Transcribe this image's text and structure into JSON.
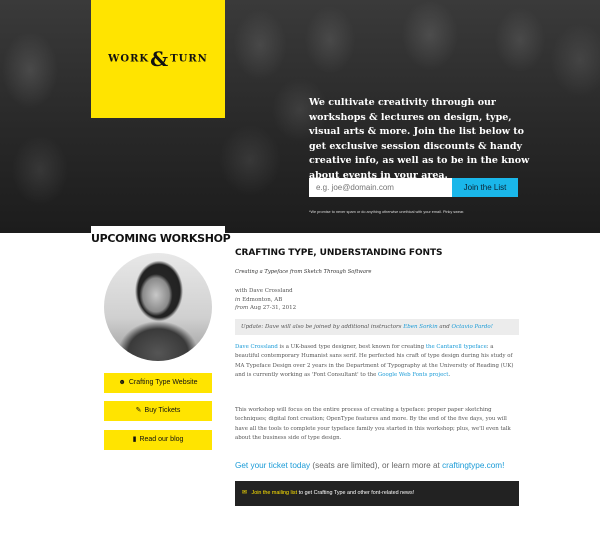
{
  "logo": {
    "word1": "WORK",
    "amp": "&",
    "word2": "TURN"
  },
  "hero": {
    "tagline": "We cultivate creativity through our workshops & lectures on design, type, visual arts & more. Join the list below to get exclusive session discounts & handy creative info, as well as to be in the know about events in your area.",
    "email_placeholder": "e.g. joe@domain.com",
    "join_label": "Join the List",
    "promise": "*We promise to never spam or do anything otherwise unethical with your email. Pinky swear."
  },
  "sidebar": {
    "heading": "UPCOMING WORKSHOP",
    "buttons": [
      {
        "icon": "globe-icon",
        "glyph": "☻",
        "label": "Crafting Type Website"
      },
      {
        "icon": "ticket-icon",
        "glyph": "✎",
        "label": "Buy Tickets"
      },
      {
        "icon": "book-icon",
        "glyph": "▮",
        "label": "Read our blog"
      }
    ]
  },
  "workshop": {
    "title": "CRAFTING TYPE, UNDERSTANDING FONTS",
    "subtitle": "Creating a Typeface from Sketch Through Software",
    "with_line": "with Dave Crossland",
    "in_label": "in",
    "location": "Edmonton, AB",
    "from_label": "from",
    "dates": "Aug 27-31, 2012",
    "update": {
      "prefix": "Update: Dave will also be joined by additional instructors",
      "instructor1": "Eben Sorkin",
      "and": "and",
      "instructor2": "Octavio Pardo!"
    },
    "bio": {
      "name_link": "Dave Crossland",
      "text1": "is a UK-based type designer, best known for creating",
      "font_link": "the Cantarell typeface",
      "text2": ": a beautiful contemporary Humanist sans serif. He perfected his craft of type design during his study of MA Typeface Design over 2 years in the Department of Typography at the University of Reading (UK) and is currently working as 'Font Consultant' to the",
      "gwf_link": "Google Web Fonts project",
      "text3": "."
    },
    "description": "This workshop will focus on the entire process of creating a typeface: proper paper sketching techniques; digital font creation; OpenType features and more. By the end of the five days, you will have all the tools to complete your typeface family you started in this workshop; plus, we'll even talk about the business side of type design.",
    "cta": {
      "ticket_link": "Get your ticket today",
      "middle": "(seats are limited), or learn more at",
      "site_link": "craftingtype.com!"
    },
    "mailing": {
      "link": "Join the mailing list",
      "text": "to get Crafting Type and other font-related news!"
    }
  },
  "colors": {
    "accent_yellow": "#ffe400",
    "link_blue": "#1a9bd7",
    "button_blue": "#1ab7ea",
    "dark": "#222222"
  }
}
